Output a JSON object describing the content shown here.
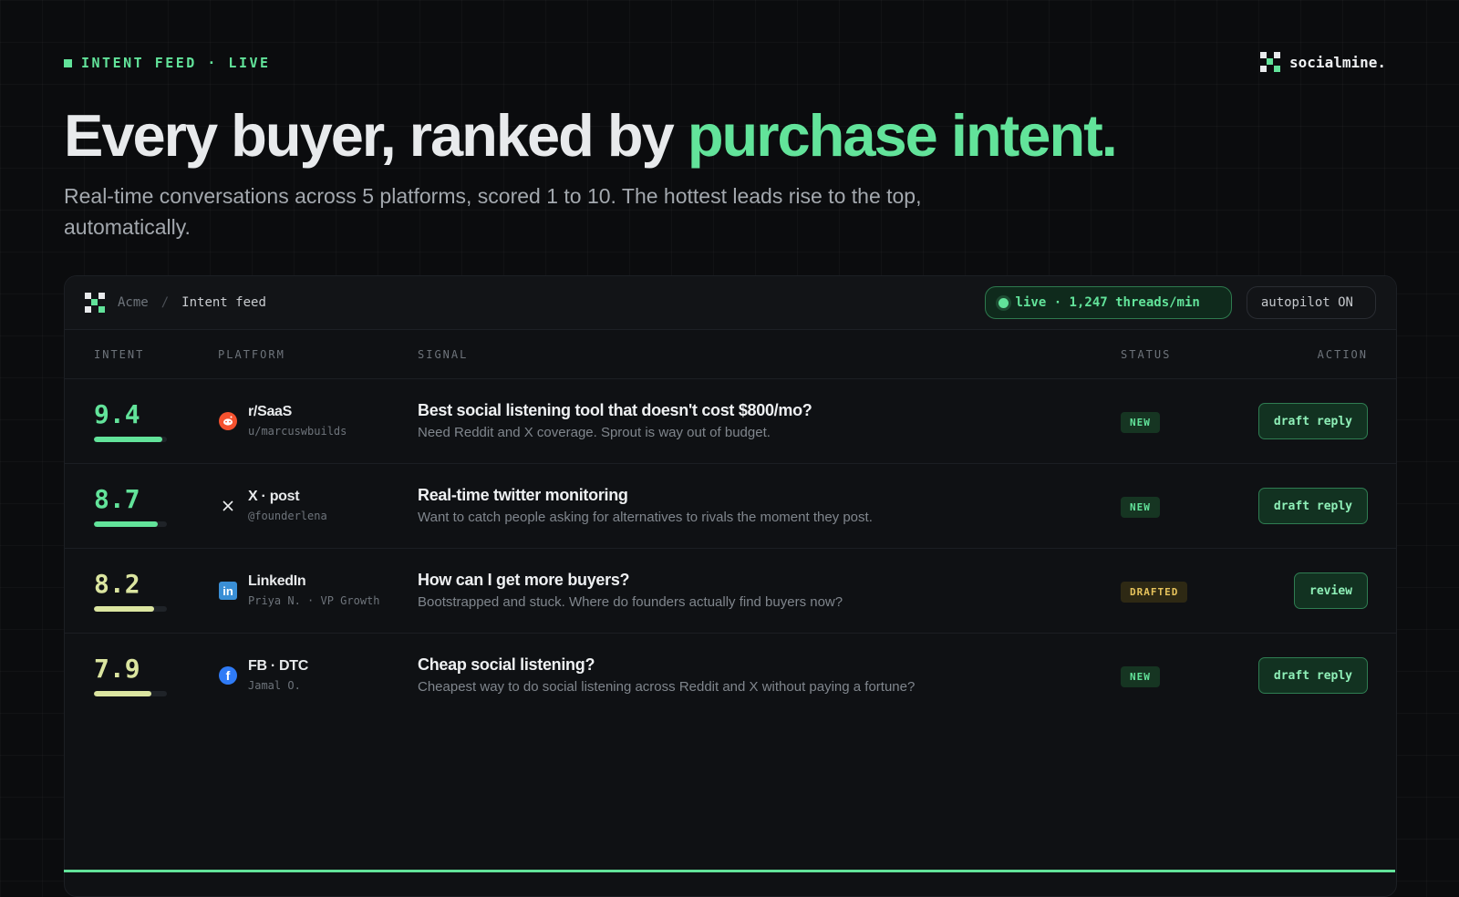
{
  "eyebrow": {
    "text": "INTENT FEED · LIVE"
  },
  "brand": {
    "name": "socialmine."
  },
  "hero": {
    "headline_main": "Every buyer, ranked by ",
    "headline_accent": "purchase intent.",
    "subhead": "Real-time conversations across 5 platforms, scored 1 to 10. The hottest leads rise to the top, automatically."
  },
  "panel": {
    "breadcrumb": {
      "org": "Acme",
      "separator": "/",
      "page": "Intent feed"
    },
    "live_pill": "live · 1,247 threads/min",
    "autopilot_pill": "autopilot ON"
  },
  "table": {
    "columns": {
      "intent": "INTENT",
      "platform": "PLATFORM",
      "signal": "SIGNAL",
      "status": "STATUS",
      "action": "ACTION"
    },
    "rows": [
      {
        "score": "9.4",
        "intent_fraction": 0.94,
        "platform_icon": "reddit-icon",
        "platform": "r/SaaS",
        "handle": "u/marcuswbuilds",
        "title": "Best social listening tool that doesn't cost $800/mo?",
        "snippet": "Need Reddit and X coverage. Sprout is way out of budget.",
        "status": "NEW",
        "action": "draft reply"
      },
      {
        "score": "8.7",
        "intent_fraction": 0.87,
        "platform_icon": "x-icon",
        "platform": "X · post",
        "handle": "@founderlena",
        "title": "Real-time twitter monitoring",
        "snippet": "Want to catch people asking for alternatives to rivals the moment they post.",
        "status": "NEW",
        "action": "draft reply"
      },
      {
        "score": "8.2",
        "intent_fraction": 0.82,
        "platform_icon": "linkedin-icon",
        "platform": "LinkedIn",
        "handle": "Priya N. · VP Growth",
        "title": "How can I get more buyers?",
        "snippet": "Bootstrapped and stuck. Where do founders actually find buyers now?",
        "status": "DRAFTED",
        "action": "review"
      },
      {
        "score": "7.9",
        "intent_fraction": 0.79,
        "platform_icon": "facebook-icon",
        "platform": "FB · DTC",
        "handle": "Jamal O.",
        "title": "Cheap social listening?",
        "snippet": "Cheapest way to do social listening across Reddit and X without paying a fortune?",
        "status": "NEW",
        "action": "draft reply"
      }
    ]
  },
  "colors": {
    "accent": "#62e39a",
    "warm": "#dbe5a0",
    "drafted": "#e6c35c",
    "background": "#0b0c0e"
  }
}
